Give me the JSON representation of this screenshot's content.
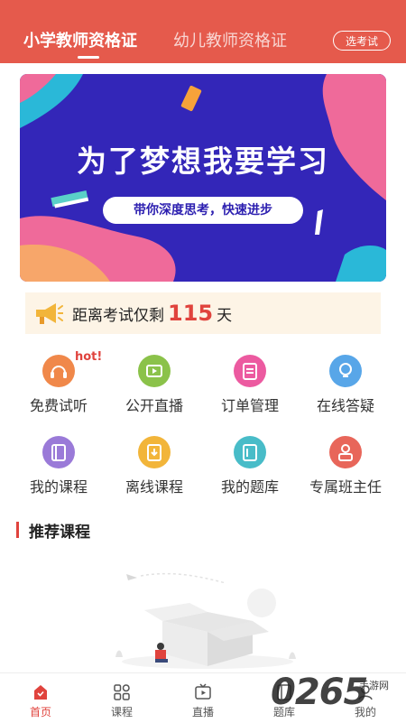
{
  "header": {
    "tabs": [
      {
        "label": "小学教师资格证",
        "active": true
      },
      {
        "label": "幼儿教师资格证",
        "active": false
      }
    ],
    "choose_exam_label": "选考试"
  },
  "banner": {
    "title": "为了梦想我要学习",
    "subtitle": "带你深度思考，快速进步"
  },
  "countdown": {
    "prefix": "距离考试仅剩",
    "days": "115",
    "suffix": "天"
  },
  "grid": [
    {
      "label": "免费试听",
      "icon": "headset-icon",
      "color": "#f0884a",
      "badge": "hot!"
    },
    {
      "label": "公开直播",
      "icon": "tv-icon",
      "color": "#8bc24a"
    },
    {
      "label": "订单管理",
      "icon": "clipboard-icon",
      "color": "#ec5aa0"
    },
    {
      "label": "在线答疑",
      "icon": "lightbulb-icon",
      "color": "#58a6e8"
    },
    {
      "label": "我的课程",
      "icon": "book-icon",
      "color": "#9a7ad8"
    },
    {
      "label": "离线课程",
      "icon": "download-book-icon",
      "color": "#f2b53a"
    },
    {
      "label": "我的题库",
      "icon": "question-bank-icon",
      "color": "#48bcc8"
    },
    {
      "label": "专属班主任",
      "icon": "teacher-icon",
      "color": "#e8665a"
    }
  ],
  "section": {
    "title": "推荐课程"
  },
  "bottom_nav": [
    {
      "label": "首页",
      "icon": "home-icon",
      "active": true
    },
    {
      "label": "课程",
      "icon": "grid-icon",
      "active": false
    },
    {
      "label": "直播",
      "icon": "tv-icon",
      "active": false
    },
    {
      "label": "题库",
      "icon": "question-bank-icon",
      "active": false
    },
    {
      "label": "我的",
      "icon": "user-icon",
      "active": false
    }
  ],
  "watermark": {
    "text": "0265",
    "sub": "手游网"
  },
  "colors": {
    "header": "#e55a4c",
    "accent": "#e0433d",
    "banner": "#3326b8"
  }
}
